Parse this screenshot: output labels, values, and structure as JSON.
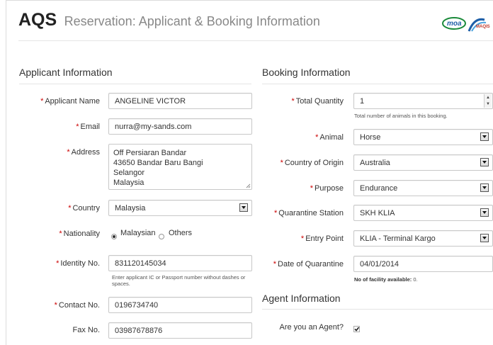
{
  "header": {
    "brand": "AQS",
    "subtitle": "Reservation: Applicant & Booking Information",
    "logo_text": "moa",
    "logo_text2": "MAQIS"
  },
  "applicant": {
    "section_title": "Applicant Information",
    "name_label": "Applicant Name",
    "name_value": "ANGELINE VICTOR",
    "email_label": "Email",
    "email_value": "nurra@my-sands.com",
    "address_label": "Address",
    "address_lines": [
      "Off Persiaran Bandar",
      "43650 Bandar Baru Bangi",
      "Selangor",
      "Malaysia"
    ],
    "country_label": "Country",
    "country_value": "Malaysia",
    "nationality_label": "Nationality",
    "nationality_options": [
      "Malaysian",
      "Others"
    ],
    "nationality_selected": "Malaysian",
    "identity_label": "Identity No.",
    "identity_value": "831120145034",
    "identity_help": "Enter applicant IC or Passport number without dashes or spaces.",
    "contact_label": "Contact No.",
    "contact_value": "0196734740",
    "fax_label": "Fax No.",
    "fax_value": "03987678876"
  },
  "booking": {
    "section_title": "Booking Information",
    "quantity_label": "Total Quantity",
    "quantity_value": "1",
    "quantity_help": "Total number of animals in this booking.",
    "animal_label": "Animal",
    "animal_value": "Horse",
    "origin_label": "Country of Origin",
    "origin_value": "Australia",
    "purpose_label": "Purpose",
    "purpose_value": "Endurance",
    "station_label": "Quarantine Station",
    "station_value": "SKH KLIA",
    "entry_label": "Entry Point",
    "entry_value": "KLIA - Terminal Kargo",
    "date_label": "Date of Quarantine",
    "date_value": "04/01/2014",
    "facility_help_bold": "No of facility available:",
    "facility_help_value": "0."
  },
  "agent": {
    "section_title": "Agent Information",
    "is_agent_label": "Are you an Agent?",
    "is_agent_checked": true
  },
  "required_mark": "*",
  "colors": {
    "required": "#cc0000",
    "logo_green": "#1a8a3a",
    "logo_blue": "#1f5fa8"
  }
}
